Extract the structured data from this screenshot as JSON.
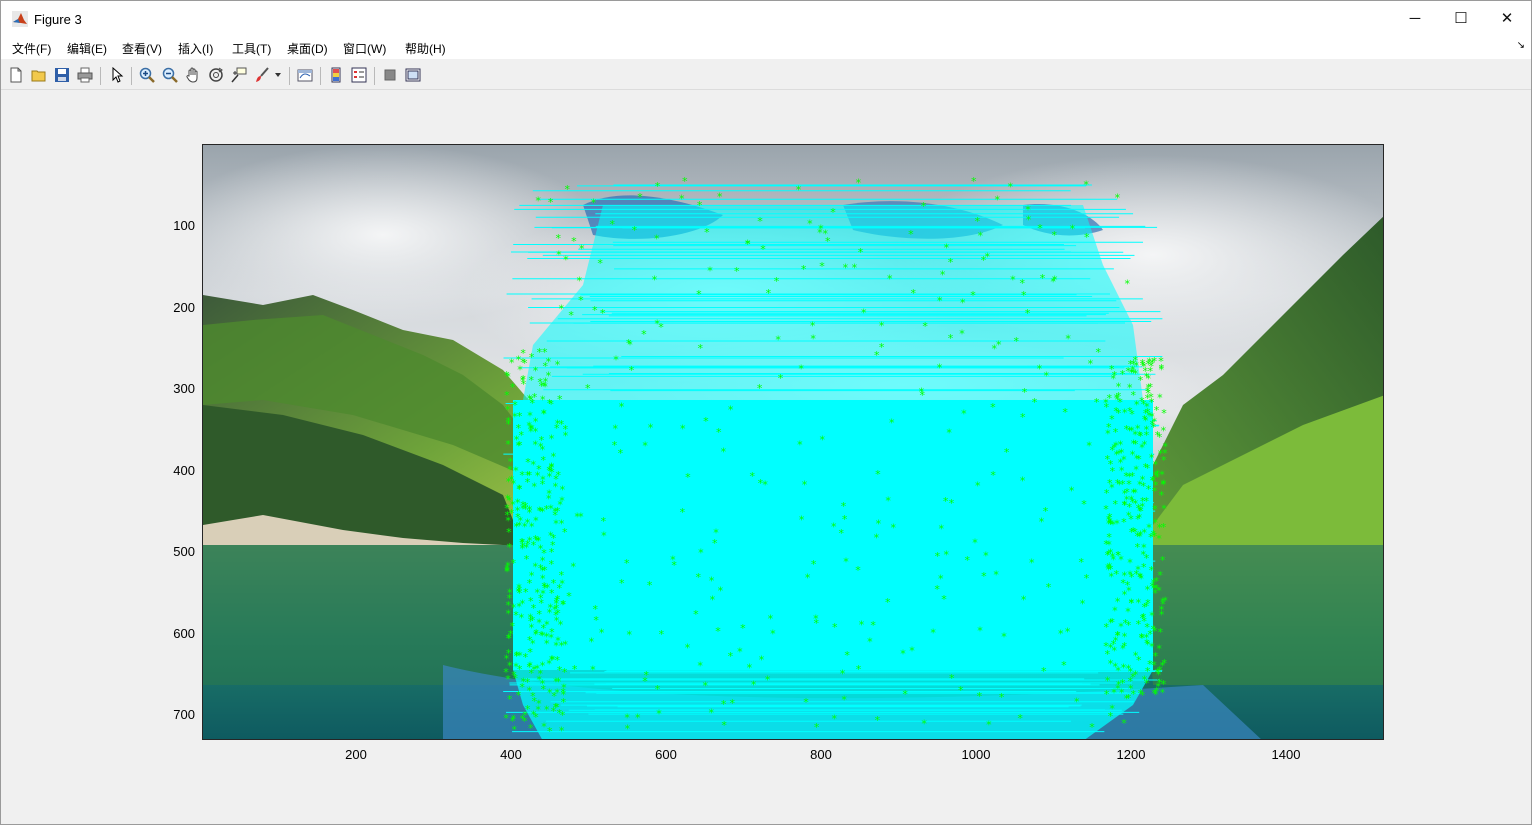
{
  "window": {
    "title": "Figure 3",
    "controls": {
      "minimize": "─",
      "maximize": "☐",
      "close": "✕"
    }
  },
  "menu": {
    "items": [
      "文件(F)",
      "编辑(E)",
      "查看(V)",
      "插入(I)",
      "工具(T)",
      "桌面(D)",
      "窗口(W)",
      "帮助(H)"
    ],
    "dock_arrow": "↘"
  },
  "toolbar": {
    "icons": [
      "new-figure-icon",
      "open-file-icon",
      "save-icon",
      "print-icon",
      "select-arrow-icon",
      "zoom-in-icon",
      "zoom-out-icon",
      "pan-hand-icon",
      "rotate-3d-icon",
      "data-cursor-icon",
      "brush-icon",
      "brush-dropdown-icon",
      "link-plot-icon",
      "colorbar-icon",
      "legend-icon",
      "hide-plot-tools-icon",
      "show-plot-tools-icon"
    ]
  },
  "plot": {
    "y_ticks": [
      "100",
      "200",
      "300",
      "400",
      "500",
      "600",
      "700"
    ],
    "x_ticks": [
      "200",
      "400",
      "600",
      "800",
      "1000",
      "1200",
      "1400"
    ],
    "colors": {
      "match_line": "#00ffff",
      "marker": "#00ff00",
      "axes_border": "#262626"
    }
  }
}
